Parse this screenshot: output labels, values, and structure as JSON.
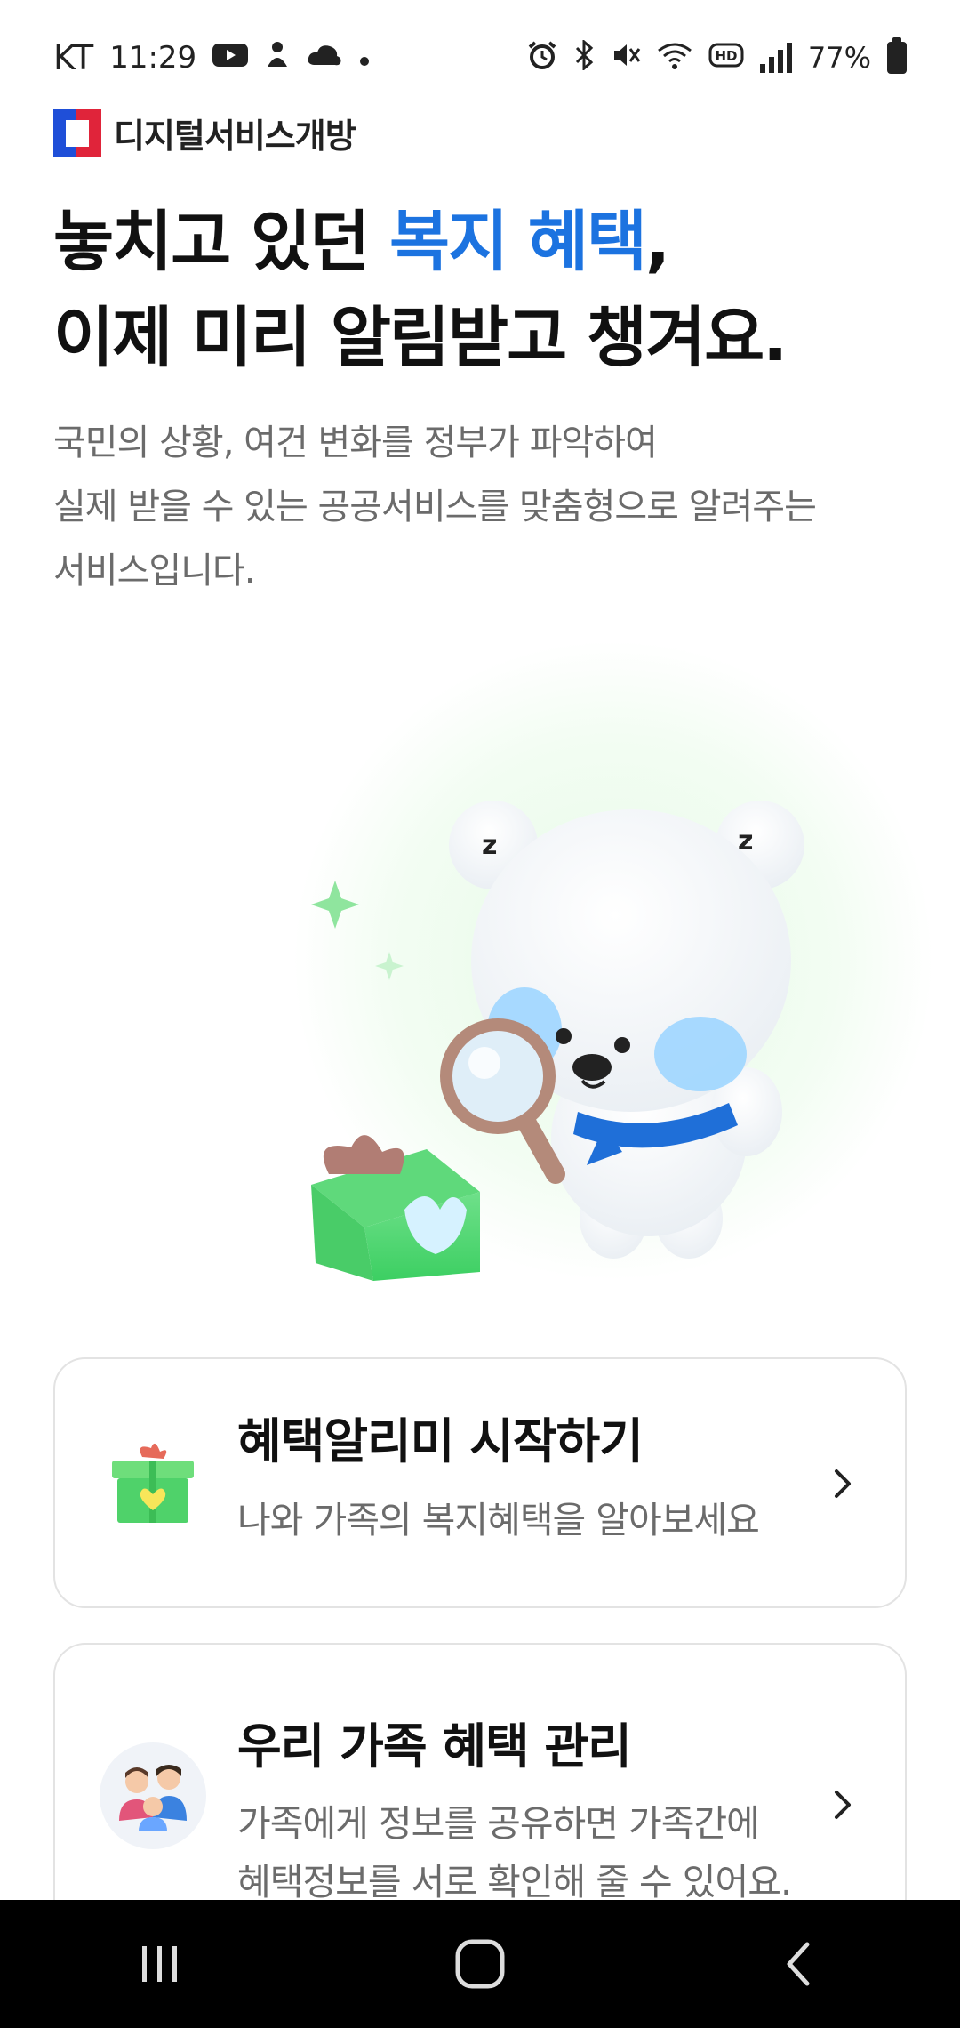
{
  "status_bar": {
    "carrier": "KT",
    "time": "11:29",
    "battery": "77%",
    "left_icons": [
      "youtube-icon",
      "notification-icon",
      "cloud-icon",
      "dot-icon"
    ],
    "right_icons": [
      "alarm-icon",
      "bluetooth-icon",
      "mute-icon",
      "wifi-icon",
      "hd-icon",
      "signal-icon",
      "battery-icon"
    ]
  },
  "brand": {
    "name": "디지털서비스개방"
  },
  "headline": {
    "line1_before": "놓치고 있던 ",
    "line1_accent": "복지 혜택",
    "line1_after": ",",
    "line2": "이제 미리 알림받고 챙겨요."
  },
  "description": {
    "lines": [
      "국민의 상황, 여건 변화를 정부가 파악하여",
      "실제 받을 수 있는 공공서비스를 맞춤형으로 알려주는",
      "서비스입니다."
    ]
  },
  "cards": [
    {
      "title": "혜택알리미 시작하기",
      "desc_lines": [
        "나와 가족의 복지혜택을 알아보세요"
      ],
      "icon": "gift-icon"
    },
    {
      "title": "우리 가족 혜택 관리",
      "desc_lines": [
        "가족에게 정보를 공유하면 가족간에",
        "혜택정보를 서로 확인해 줄 수 있어요."
      ],
      "icon": "family-icon"
    }
  ],
  "colors": {
    "accent": "#1c73e0",
    "text": "#111111",
    "subtext": "#6b6b6b",
    "card_border": "#e3e3e3"
  },
  "nav_bar": {
    "buttons": [
      "recent-apps-icon",
      "home-icon",
      "back-icon"
    ]
  }
}
